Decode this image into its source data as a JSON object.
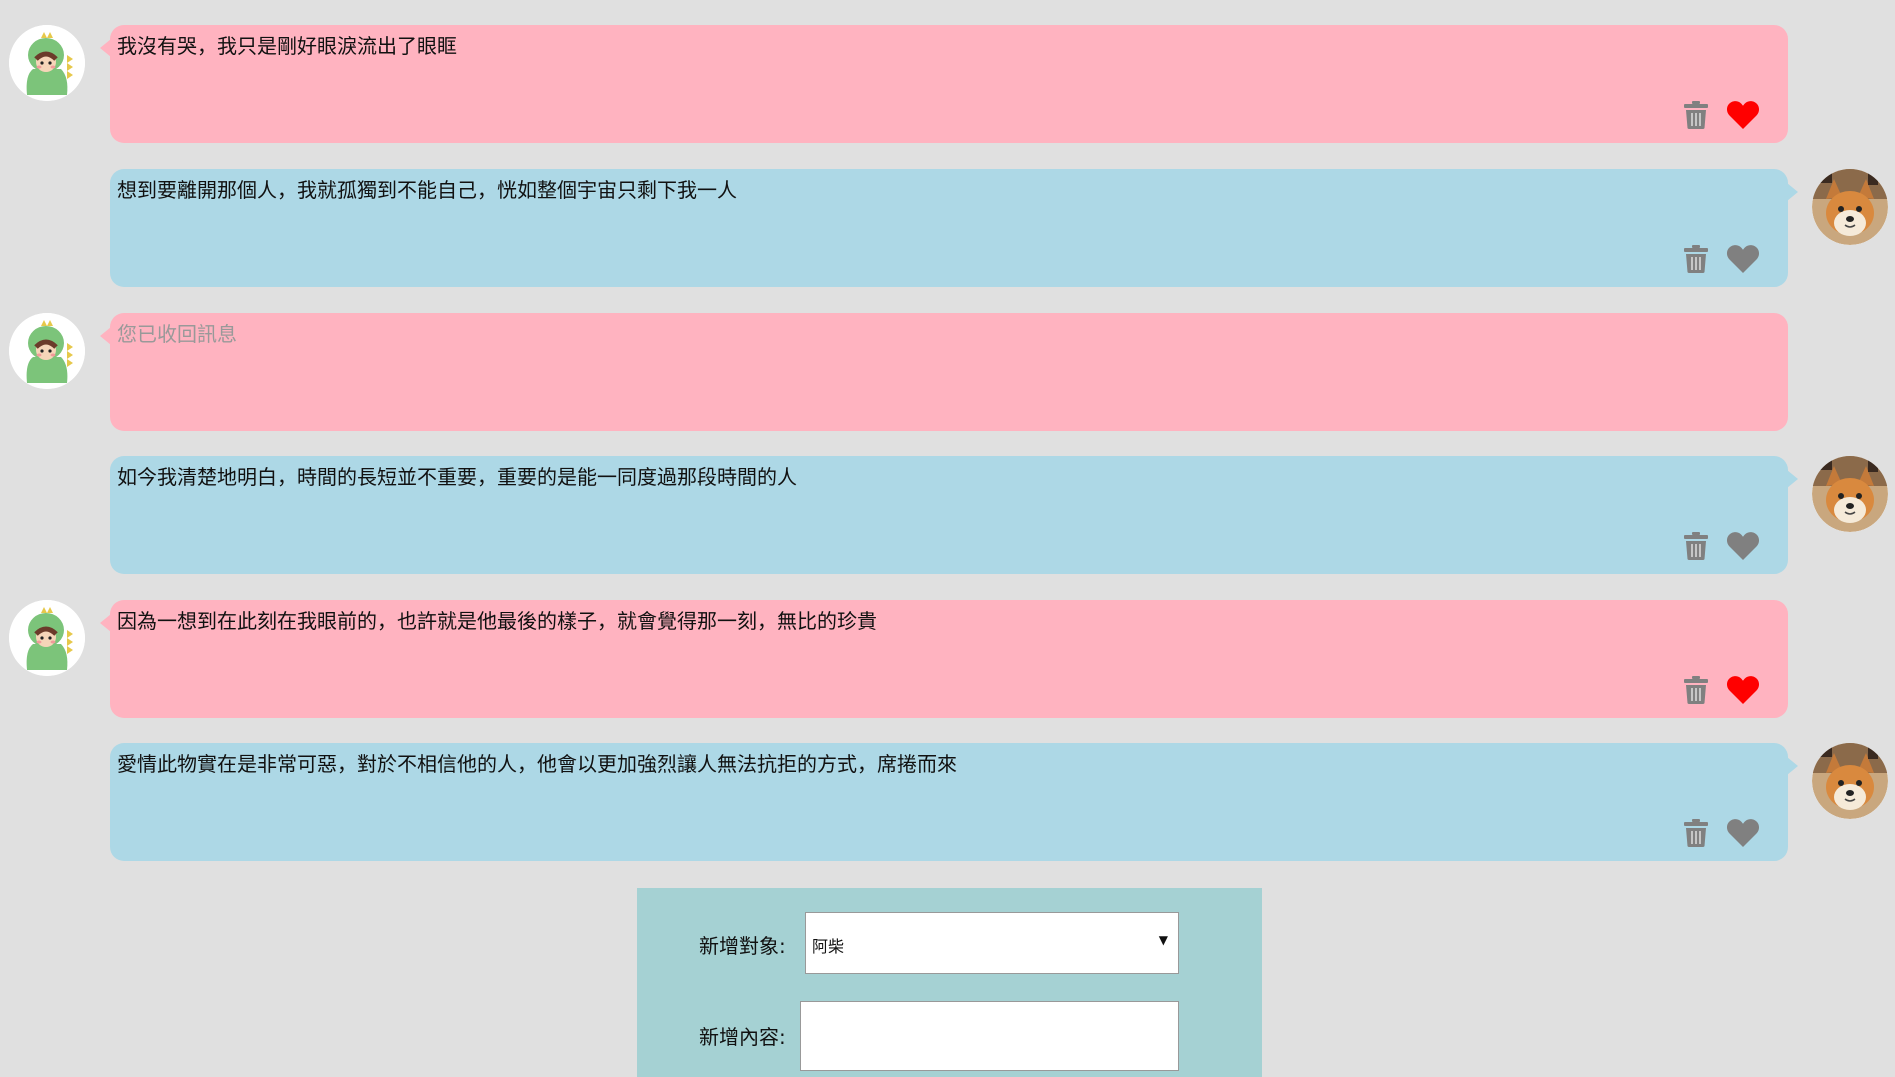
{
  "messages": [
    {
      "side": "left",
      "text": "我沒有哭，我只是剛好眼淚流出了眼眶",
      "recalled": false,
      "liked": true,
      "avatar_icon": "dinosaur-girl-avatar"
    },
    {
      "side": "right",
      "text": "想到要離開那個人，我就孤獨到不能自己，恍如整個宇宙只剩下我一人",
      "recalled": false,
      "liked": false,
      "avatar_icon": "shiba-dog-avatar"
    },
    {
      "side": "left",
      "text": "您已收回訊息",
      "recalled": true,
      "liked": false,
      "avatar_icon": "dinosaur-girl-avatar"
    },
    {
      "side": "right",
      "text": "如今我清楚地明白，時間的長短並不重要，重要的是能一同度過那段時間的人",
      "recalled": false,
      "liked": false,
      "avatar_icon": "shiba-dog-avatar"
    },
    {
      "side": "left",
      "text": "因為一想到在此刻在我眼前的，也許就是他最後的樣子，就會覺得那一刻，無比的珍貴",
      "recalled": false,
      "liked": true,
      "avatar_icon": "dinosaur-girl-avatar"
    },
    {
      "side": "right",
      "text": "愛情此物實在是非常可惡，對於不相信他的人，他會以更加強烈讓人無法抗拒的方式，席捲而來",
      "recalled": false,
      "liked": false,
      "avatar_icon": "shiba-dog-avatar"
    }
  ],
  "form": {
    "target_label": "新增對象:",
    "target_value": "阿柴",
    "content_label": "新增內容:",
    "content_value": ""
  },
  "colors": {
    "background": "#e0e0e0",
    "left_bubble": "#ffb3c0",
    "right_bubble": "#add8e6",
    "liked_heart": "#ff0000",
    "unliked_heart": "#808080",
    "trash": "#808080",
    "form_panel": "#a5d1d3"
  }
}
